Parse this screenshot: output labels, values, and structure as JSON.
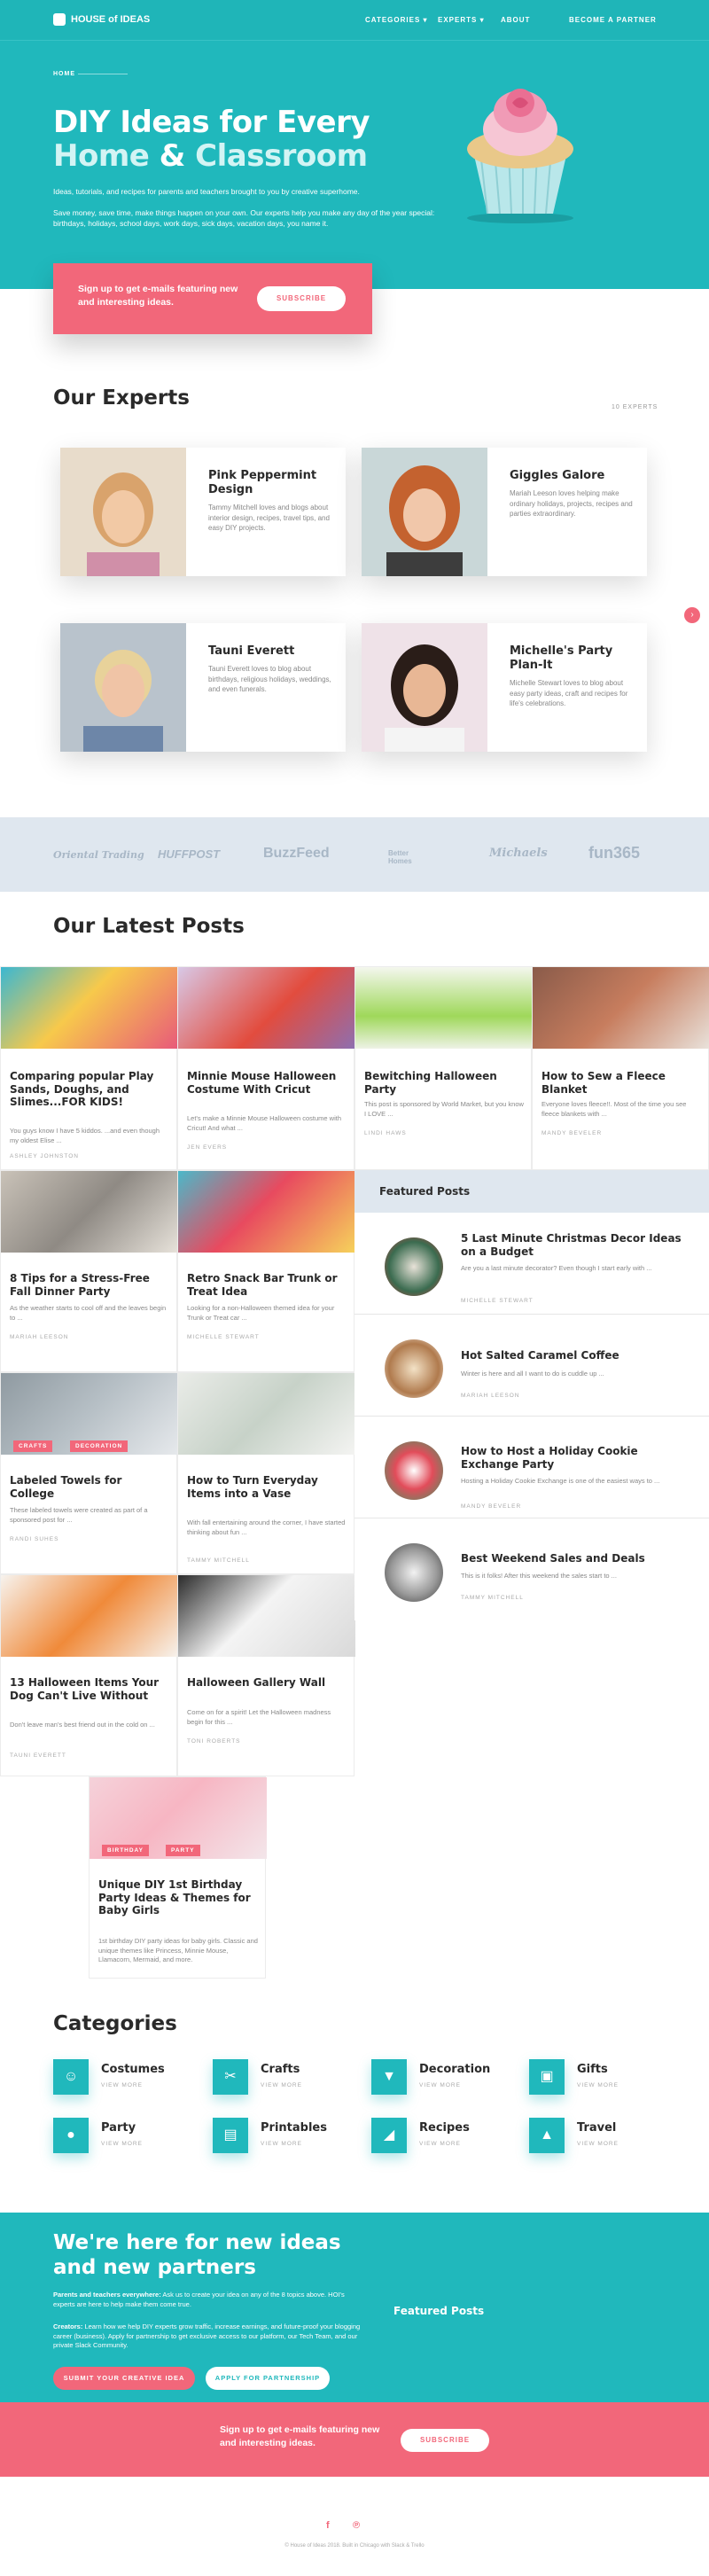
{
  "nav": {
    "brand": "HOUSE of IDEAS",
    "items": [
      "CATEGORIES",
      "EXPERTS",
      "ABOUT"
    ],
    "partner": "BECOME A PARTNER"
  },
  "hero": {
    "breadcrumb": "HOME",
    "title_line1": "DIY Ideas for Every",
    "title_home": "Home",
    "title_amp": "&",
    "title_classroom": "Classroom",
    "lead": "Ideas, tutorials, and recipes for parents and teachers brought to you by creative superhome.",
    "body": "Save money, save time, make things happen on your own. Our experts help you make any day of the year special: birthdays, holidays, school days, work days, sick days, vacation days, you name it."
  },
  "signup": {
    "text": "Sign up to get e-mails featuring new and interesting ideas.",
    "button": "SUBSCRIBE"
  },
  "experts": {
    "heading": "Our Experts",
    "count": "10 EXPERTS",
    "items": [
      {
        "name": "Pink Peppermint Design",
        "desc": "Tammy Mitchell loves and blogs about interior design, recipes, travel tips, and easy DIY projects."
      },
      {
        "name": "Giggles Galore",
        "desc": "Mariah Leeson loves helping make ordinary holidays, projects, recipes and parties extraordinary."
      },
      {
        "name": "Tauni Everett",
        "desc": "Tauni Everett loves to blog about birthdays, religious holidays, weddings, and even funerals."
      },
      {
        "name": "Michelle's Party Plan-It",
        "desc": "Michelle Stewart loves to blog about easy party ideas, craft and recipes for life's celebrations."
      }
    ]
  },
  "press": [
    "Oriental Trading",
    "HUFFPOST",
    "BuzzFeed",
    "Better Homes",
    "Michaels",
    "fun365"
  ],
  "posts": {
    "heading": "Our Latest Posts",
    "items": [
      {
        "title": "Comparing popular Play Sands, Doughs, and Slimes...FOR KIDS!",
        "excerpt": "You guys know I have 5 kiddos. ...and even though my oldest Elise ...",
        "author": "ASHLEY JOHNSTON"
      },
      {
        "title": "Minnie Mouse Halloween Costume With Cricut",
        "excerpt": "Let's make a Minnie Mouse Halloween costume with Cricut! And what ...",
        "author": "JEN EVERS"
      },
      {
        "title": "Bewitching Halloween Party",
        "excerpt": "This post is sponsored by World Market, but you know I LOVE ...",
        "author": "LINDI HAWS"
      },
      {
        "title": "How to Sew a Fleece Blanket",
        "excerpt": "Everyone loves fleece!!. Most of the time you see fleece blankets with ...",
        "author": "MANDY BEVELER"
      },
      {
        "title": "8 Tips for a Stress-Free Fall Dinner Party",
        "excerpt": "As the weather starts to cool off and the leaves begin to ...",
        "author": "MARIAH LEESON"
      },
      {
        "title": "Retro Snack Bar Trunk or Treat Idea",
        "excerpt": "Looking for a non-Halloween themed idea for your Trunk or Treat car ...",
        "author": "MICHELLE STEWART"
      },
      {
        "title": "Labeled Towels for College",
        "excerpt": "These labeled towels were created as part of a sponsored post for ...",
        "author": "RANDI SUHES",
        "tags": [
          "CRAFTS",
          "DECORATION"
        ]
      },
      {
        "title": "How to Turn Everyday Items into a Vase",
        "excerpt": "With fall entertaining around the corner, I have started thinking about fun ...",
        "author": "TAMMY MITCHELL"
      },
      {
        "title": "13 Halloween Items Your Dog Can't Live Without",
        "excerpt": "Don't leave man's best friend out in the cold on ...",
        "author": "TAUNI EVERETT"
      },
      {
        "title": "Halloween Gallery Wall",
        "excerpt": "Come on for a spirit! Let the Halloween madness begin for this ...",
        "author": "TONI ROBERTS"
      },
      {
        "title": "Unique DIY 1st Birthday Party Ideas & Themes for Baby Girls",
        "excerpt": "1st birthday DIY party ideas for baby girls. Classic and unique themes like Princess, Minnie Mouse, Llamacorn, Mermaid, and more.",
        "author": "",
        "tags": [
          "BIRTHDAY",
          "PARTY"
        ]
      }
    ]
  },
  "featured": {
    "heading": "Featured Posts",
    "items": [
      {
        "title": "5 Last Minute Christmas Decor Ideas on a Budget",
        "excerpt": "Are you a last minute decorator? Even though I start early with ...",
        "author": "MICHELLE STEWART"
      },
      {
        "title": "Hot Salted Caramel Coffee",
        "excerpt": "Winter is here and all I want to do is cuddle up ...",
        "author": "MARIAH LEESON"
      },
      {
        "title": "How to Host a Holiday Cookie Exchange Party",
        "excerpt": "Hosting a Holiday Cookie Exchange is one of the easiest ways to ...",
        "author": "MANDY BEVELER"
      },
      {
        "title": "Best Weekend Sales and Deals",
        "excerpt": "This is it folks! After this weekend the sales start to ...",
        "author": "TAMMY MITCHELL"
      }
    ]
  },
  "categories": {
    "heading": "Categories",
    "view_more": "VIEW MORE",
    "items": [
      {
        "name": "Costumes",
        "icon": "costume-icon"
      },
      {
        "name": "Crafts",
        "icon": "crafts-icon"
      },
      {
        "name": "Decoration",
        "icon": "decoration-icon"
      },
      {
        "name": "Gifts",
        "icon": "gifts-icon"
      },
      {
        "name": "Party",
        "icon": "party-icon"
      },
      {
        "name": "Printables",
        "icon": "printables-icon"
      },
      {
        "name": "Recipes",
        "icon": "recipes-icon"
      },
      {
        "name": "Travel",
        "icon": "travel-icon"
      }
    ]
  },
  "partner": {
    "heading_line1": "We're here for new ideas",
    "heading_line2": "and new partners",
    "p1_label": "Parents and teachers everywhere:",
    "p1": "Ask us to create your idea on any of the 8 topics above. HOI's experts are here to help make them come true.",
    "p2_label": "Creators:",
    "p2": "Learn how we help DIY experts grow traffic, increase earnings, and future-proof your blogging career (business). Apply for partnership to get exclusive access to our platform, our Tech Team, and our private Slack Community.",
    "btn1": "SUBMIT YOUR CREATIVE IDEA",
    "btn2": "APPLY FOR PARTNERSHIP",
    "featured": "Featured Posts"
  },
  "signup2": {
    "text": "Sign up to get e-mails featuring new and interesting ideas.",
    "button": "SUBSCRIBE"
  },
  "footer": {
    "copyright": "© House of Ideas 2018. Built in Chicago with Slack & Trello"
  },
  "colors": {
    "teal": "#20b8bc",
    "pink": "#f2677a"
  }
}
